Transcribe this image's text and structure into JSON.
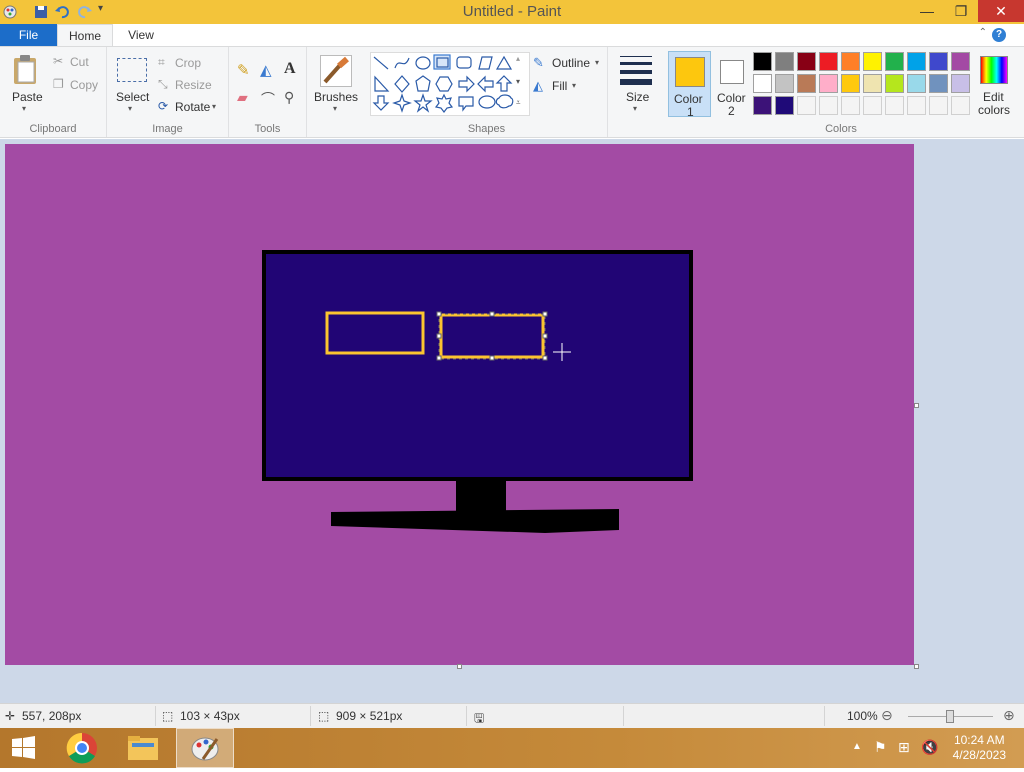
{
  "window": {
    "title": "Untitled - Paint",
    "controls": {
      "minimize": "—",
      "restore": "❐",
      "close": "✕"
    }
  },
  "tabs": {
    "file": "File",
    "home": "Home",
    "view": "View",
    "help": "?"
  },
  "ribbon": {
    "clipboard": {
      "label": "Clipboard",
      "paste": "Paste",
      "cut": "Cut",
      "copy": "Copy"
    },
    "image": {
      "label": "Image",
      "select": "Select",
      "crop": "Crop",
      "resize": "Resize",
      "rotate": "Rotate"
    },
    "tools": {
      "label": "Tools"
    },
    "brushes": {
      "label": "Brushes"
    },
    "shapes": {
      "label": "Shapes",
      "outline": "Outline",
      "fill": "Fill"
    },
    "size": {
      "label": "Size"
    },
    "color1": {
      "label_line1": "Color",
      "label_line2": "1",
      "value": "#fdc70e"
    },
    "color2": {
      "label_line1": "Color",
      "label_line2": "2",
      "value": "#ffffff"
    },
    "colors": {
      "label": "Colors",
      "edit_line1": "Edit",
      "edit_line2": "colors"
    },
    "palette_row1": [
      "#000000",
      "#7f7f7f",
      "#880015",
      "#ed1c24",
      "#ff7f27",
      "#fff200",
      "#22b14c",
      "#00a2e8",
      "#3f48cc",
      "#a349a4"
    ],
    "palette_row2": [
      "#ffffff",
      "#c3c3c3",
      "#b97a57",
      "#ffaec9",
      "#ffc90e",
      "#efe4b0",
      "#b5e61d",
      "#99d9ea",
      "#7092be",
      "#c8bfe7"
    ],
    "palette_row3": [
      "#3c1278",
      "#1f0a78",
      "#f4f4f4",
      "#f4f4f4",
      "#f4f4f4",
      "#f4f4f4",
      "#f4f4f4",
      "#f4f4f4",
      "#f4f4f4",
      "#f4f4f4"
    ]
  },
  "drawing": {
    "background": "#a34ba4",
    "screen_color": "#210575",
    "stand_color": "#000000",
    "rect_color": "#fcc430"
  },
  "status": {
    "cursor": "557, 208px",
    "selection": "103 × 43px",
    "canvas_size": "909 × 521px",
    "zoom": "100%"
  },
  "taskbar": {
    "time": "10:24 AM",
    "date": "4/28/2023"
  }
}
